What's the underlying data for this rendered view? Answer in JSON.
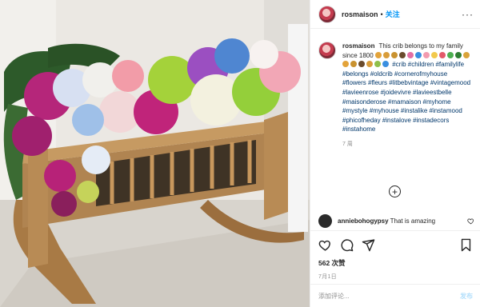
{
  "post": {
    "username": "rosmaison",
    "follow_label": "关注",
    "more_label": "···"
  },
  "caption": {
    "username": "rosmaison",
    "text": "This crib belongs to my family since 1800",
    "tags": "#crib #children #familylife #belongs #oldcrib #cornerofmyhouse #flowers #fleurs #litbebvintage #vintagemood #lavieenrose #joidevivre #lavieestbelle #maisonderose #mamaison #myhome #mystyle #myhouse #instalike #instamood #phicofheday #instalove #instadecors #instahome",
    "time": "7 周"
  },
  "emoji_colors": [
    "#e3a33a",
    "#d99d3a",
    "#c9922f",
    "#6a4b2c",
    "#e36ea3",
    "#3a8fe0",
    "#f29bb0",
    "#f2c94c",
    "#e35a6a",
    "#4caf50",
    "#2e7d32",
    "#d9a33a",
    "#e3a33a",
    "#c9922f",
    "#6a4b2c",
    "#d99d3a",
    "#8fbf4a",
    "#3a8fe0"
  ],
  "load_more_icon": "plus-circle-icon",
  "comment": {
    "username": "anniebohogypsy",
    "text": "That is amazing"
  },
  "actions": {
    "like_icon": "heart-icon",
    "comment_icon": "comment-icon",
    "share_icon": "paper-plane-icon",
    "save_icon": "bookmark-icon"
  },
  "likes": "562 次赞",
  "date": "7月1日",
  "add_comment": {
    "placeholder": "添加评论...",
    "post_label": "发布"
  },
  "colors": {
    "link": "#00376b",
    "follow": "#0095f6",
    "post_disabled": "#b2dffc",
    "muted": "#8e8e8e"
  }
}
